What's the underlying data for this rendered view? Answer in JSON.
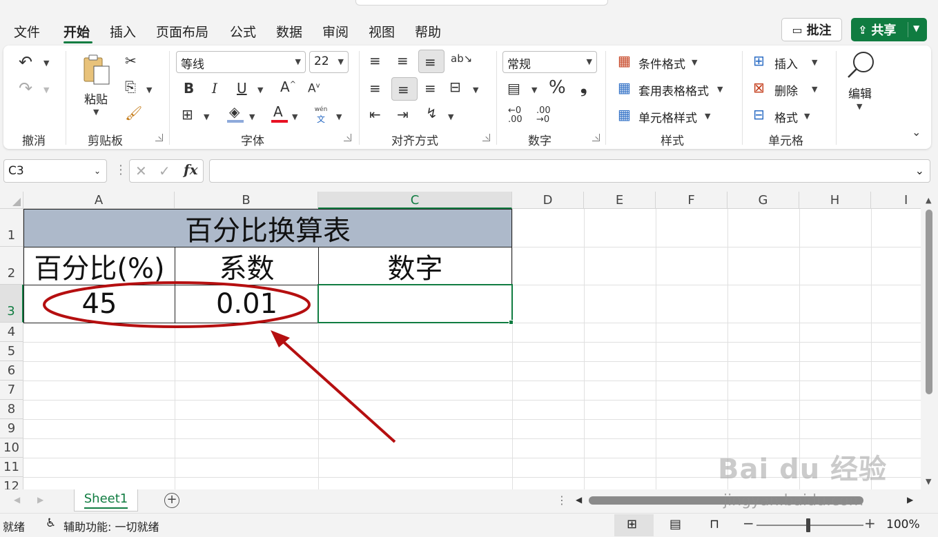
{
  "tabs": [
    "文件",
    "开始",
    "插入",
    "页面布局",
    "公式",
    "数据",
    "审阅",
    "视图",
    "帮助"
  ],
  "active_tab": "开始",
  "header_buttons": {
    "comment": "批注",
    "share": "共享"
  },
  "ribbon": {
    "groups": {
      "undo": "撤消",
      "clipboard": "剪贴板",
      "font": "字体",
      "alignment": "对齐方式",
      "number": "数字",
      "styles": "样式",
      "cells": "单元格"
    },
    "paste_label": "粘贴",
    "font_name": "等线",
    "font_size": "22",
    "wen_label": "wén",
    "wen_char": "文",
    "number_format": "常规",
    "percent": "%",
    "comma": "❟",
    "styles_items": [
      "条件格式",
      "套用表格格式",
      "单元格样式"
    ],
    "cells_items": [
      "插入",
      "删除",
      "格式"
    ],
    "edit_label": "编辑",
    "accent_color": "#107c41",
    "font_color": "#e81123"
  },
  "formula_bar": {
    "name_box": "C3",
    "formula": ""
  },
  "grid": {
    "columns": [
      "A",
      "B",
      "C",
      "D",
      "E",
      "F",
      "G",
      "H",
      "I"
    ],
    "selected_column": "C",
    "rows": [
      "1",
      "2",
      "3",
      "4",
      "5",
      "6",
      "7",
      "8",
      "9",
      "10",
      "11",
      "12"
    ],
    "selected_row": "3",
    "title": "百分比换算表",
    "headers": [
      "百分比(%)",
      "系数",
      "数字"
    ],
    "values": [
      "45",
      "0.01",
      ""
    ],
    "header_fill": "#adb9ca",
    "annotation_color": "#b50f10"
  },
  "sheet": {
    "tab": "Sheet1"
  },
  "status": {
    "ready": "就绪",
    "accessibility": "辅助功能: 一切就绪",
    "zoom": "100%",
    "zoom_minus": "−",
    "zoom_plus": "+"
  },
  "watermark": {
    "logo": "Bai du 经验",
    "url": "jingyan.baidu.com"
  }
}
